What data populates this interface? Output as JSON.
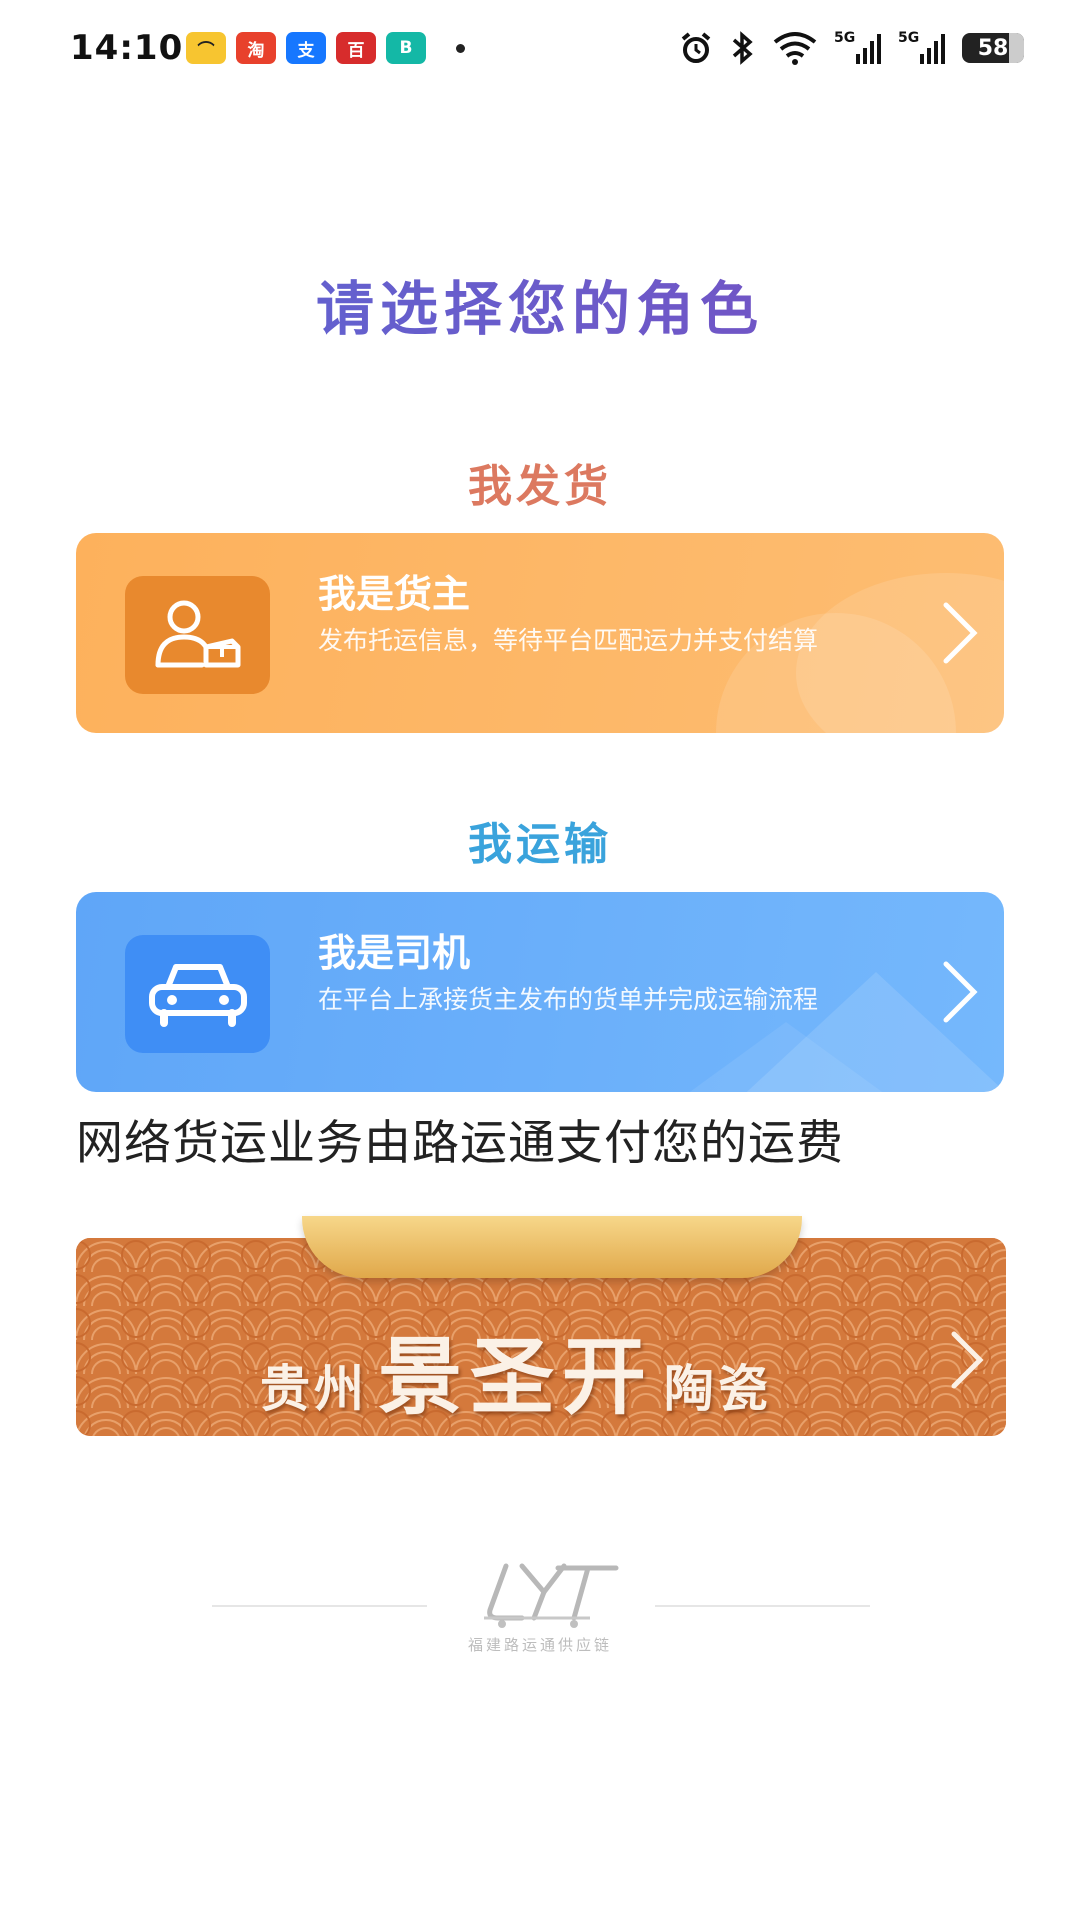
{
  "status_bar": {
    "time": "14:10",
    "apps": [
      {
        "icon": "meituan-icon",
        "color": "#f7c530",
        "glyph": "⌒"
      },
      {
        "icon": "taobao-icon",
        "color": "#e8412c",
        "glyph": "淘"
      },
      {
        "icon": "alipay-icon",
        "color": "#1677ff",
        "glyph": "支"
      },
      {
        "icon": "baifubao-icon",
        "color": "#d72c2c",
        "glyph": "百"
      },
      {
        "icon": "boss-zhipin-icon",
        "color": "#14b8a6",
        "glyph": "B"
      }
    ],
    "battery": "58",
    "network_1": "5G",
    "network_2": "5G"
  },
  "page": {
    "title": "请选择您的角色"
  },
  "sections": {
    "ship_heading": "我发货",
    "transport_heading": "我运输"
  },
  "roles": {
    "owner": {
      "title": "我是货主",
      "description": "发布托运信息，等待平台匹配运力并支付结算",
      "icon": "cargo-owner-icon"
    },
    "driver": {
      "title": "我是司机",
      "description": "在平台上承接货主发布的货单并完成运输流程",
      "icon": "car-icon"
    }
  },
  "notice": "网络货运业务由路运通支付您的运费",
  "banner": {
    "prefix": "贵州",
    "main": "景圣开",
    "suffix": "陶瓷"
  },
  "footer": {
    "logo_text": "LYT",
    "caption": "福建路运通供应链"
  },
  "colors": {
    "title_gradient_start": "#5a68d4",
    "title_gradient_end": "#7a4ec0",
    "ship_heading": "#dc7960",
    "transport_heading": "#3aa3dc",
    "owner_card": "#fdb15c",
    "driver_card": "#6aaffa",
    "banner": "#d4793c"
  }
}
